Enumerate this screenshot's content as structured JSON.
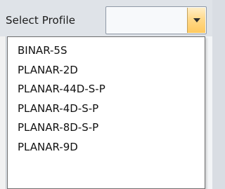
{
  "select_label": "Select Profile",
  "combo": {
    "value": "",
    "button_icon": "chevron-down-icon"
  },
  "dropdown": {
    "items": [
      "BINAR-5S",
      "PLANAR-2D",
      "PLANAR-44D-S-P",
      "PLANAR-4D-S-P",
      "PLANAR-8D-S-P",
      "PLANAR-9D"
    ]
  },
  "colors": {
    "background": "#dfe3e8",
    "combo_button": "#ffd98a",
    "dropdown_border": "#6d6d6d"
  }
}
